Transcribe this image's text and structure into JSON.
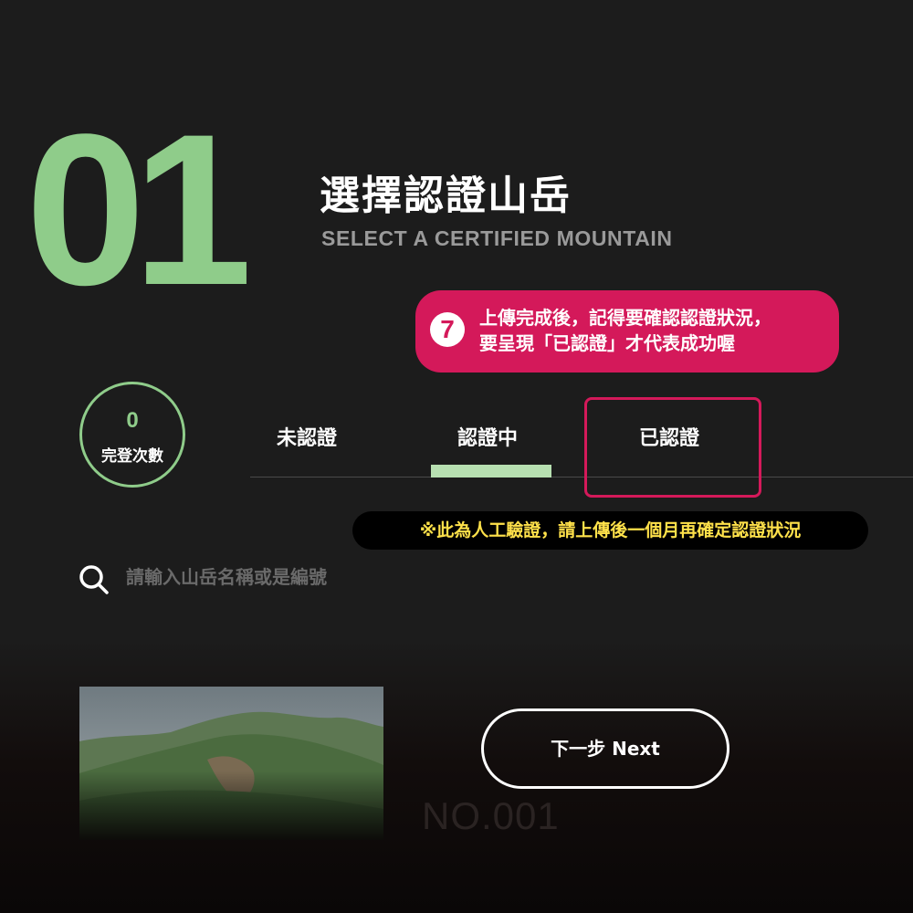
{
  "step": {
    "number": "01",
    "title": "選擇認證山岳",
    "subtitle": "SELECT A CERTIFIED MOUNTAIN"
  },
  "callout": {
    "badge": "7",
    "line1": "上傳完成後，記得要確認認證狀況，",
    "line2": "要呈現「已認證」才代表成功喔"
  },
  "summit_count": {
    "value": "0",
    "label": "完登次數"
  },
  "tabs": [
    {
      "label": "未認證",
      "active": false
    },
    {
      "label": "認證中",
      "active": true
    },
    {
      "label": "已認證",
      "active": false
    }
  ],
  "notice": "※此為人工驗證，請上傳後一個月再確定認證狀況",
  "search": {
    "placeholder": "請輸入山岳名稱或是編號",
    "icon": "search-icon"
  },
  "mountain_card": {
    "number": "NO.001"
  },
  "next_button": {
    "label": "下一步 Next"
  },
  "colors": {
    "accent_green": "#8fcc8a",
    "active_tab_bar": "#b7e0b1",
    "highlight_pink": "#d4195a",
    "notice_yellow": "#ffe14a",
    "background": "#1c1c1c"
  }
}
